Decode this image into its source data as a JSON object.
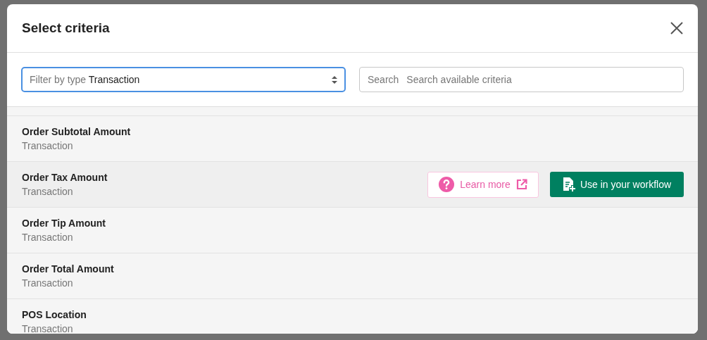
{
  "dialog": {
    "title": "Select criteria"
  },
  "filter": {
    "label": "Filter by type",
    "value": "Transaction"
  },
  "search": {
    "label": "Search",
    "placeholder": "Search available criteria"
  },
  "criteria": [
    {
      "name": "Order Subtotal Amount",
      "type": "Transaction",
      "selected": false
    },
    {
      "name": "Order Tax Amount",
      "type": "Transaction",
      "selected": true
    },
    {
      "name": "Order Tip Amount",
      "type": "Transaction",
      "selected": false
    },
    {
      "name": "Order Total Amount",
      "type": "Transaction",
      "selected": false
    },
    {
      "name": "POS Location",
      "type": "Transaction",
      "selected": false
    }
  ],
  "row_actions": [
    {
      "kind": "learn",
      "label": "Learn more"
    },
    {
      "kind": "use",
      "label": "Use in your workflow"
    }
  ]
}
